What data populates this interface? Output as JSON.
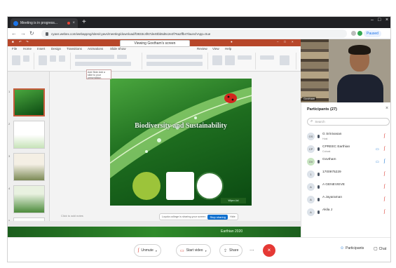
{
  "browser": {
    "tab_title": "Meeting is in progress...",
    "url": "cyavs.webex.com/webappng/sites/cyavs/meeting/download/f3833c4f67de40bb5d6c2e2f76a2ffb4?launchApp=true",
    "profile_label": "Paused"
  },
  "presentation": {
    "sharing_banner": "Viewing Govtham's screen",
    "ribbon_tabs": [
      "File",
      "Home",
      "Insert",
      "Design",
      "Transitions",
      "Animations",
      "Slide Show",
      "Review",
      "View",
      "Help"
    ],
    "tooltip": "Add Slide Add a slide to your presentation",
    "slide_title": "Biodiversity and Sustainability",
    "slide_logos": [
      "wipro earthian",
      "wipro",
      "seal"
    ],
    "slide_footer": "Wipro Ltd",
    "notes_hint": "Click to add notes",
    "share_notice": "Loyola college is sharing your screen",
    "stop_sharing": "Stop sharing",
    "hide_label": "Hide",
    "strip_label": "Earthian 2020",
    "thumb_numbers": [
      "1",
      "2",
      "3",
      "4",
      "5"
    ]
  },
  "video": {
    "name": "Govtham"
  },
  "participants": {
    "title": "Participants (27)",
    "search_placeholder": "Search",
    "rows": [
      {
        "initials": "GS",
        "name": "G Srinivasan",
        "role": "Host"
      },
      {
        "initials": "CP",
        "name": "CPREEC Earthian",
        "role": "Cohost"
      },
      {
        "initials": "GV",
        "name": "Govtham",
        "role": ""
      },
      {
        "initials": "1",
        "name": "1700975229",
        "role": ""
      },
      {
        "initials": "A",
        "name": "A GENEVIEVE",
        "role": ""
      },
      {
        "initials": "A",
        "name": "A Jayaraman",
        "role": ""
      },
      {
        "initials": "A",
        "name": "Akila J",
        "role": ""
      }
    ]
  },
  "controls": {
    "unmute": "Unmute",
    "start_video": "Start video",
    "share": "Share",
    "more": "...",
    "participants": "Participants",
    "chat": "Chat"
  }
}
